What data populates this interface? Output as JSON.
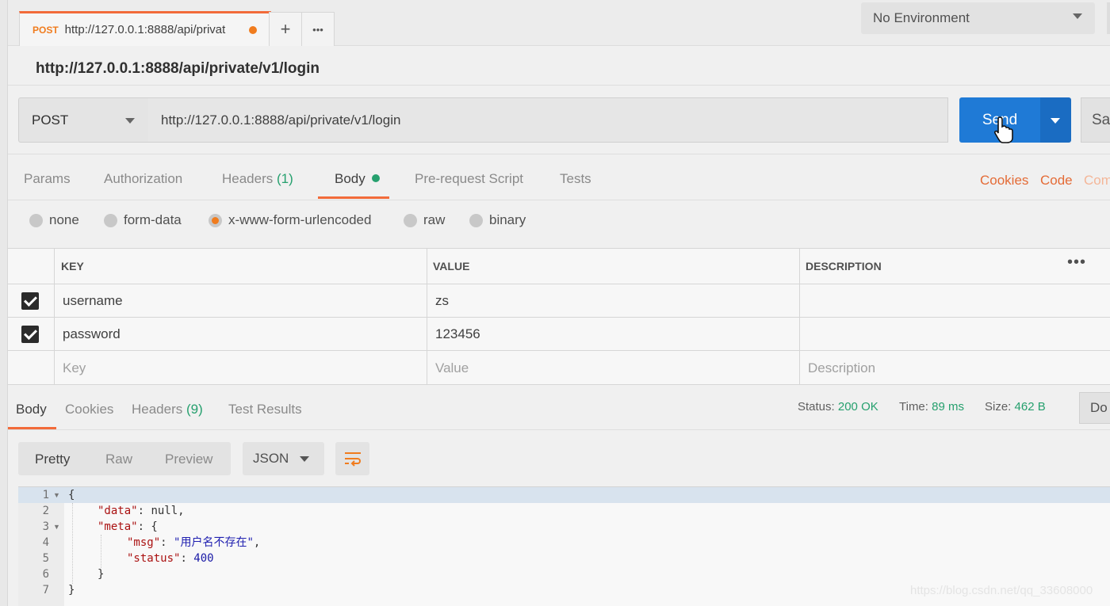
{
  "tabs": {
    "active": {
      "method": "POST",
      "url": "http://127.0.0.1:8888/api/privat"
    },
    "add_label": "+",
    "more_label": "•••"
  },
  "environment": {
    "selected": "No Environment"
  },
  "request": {
    "title": "http://127.0.0.1:8888/api/private/v1/login",
    "method": "POST",
    "url": "http://127.0.0.1:8888/api/private/v1/login",
    "send_label": "Send",
    "save_label": "Sa"
  },
  "request_tabs": {
    "params": "Params",
    "authorization": "Authorization",
    "headers": "Headers",
    "headers_count": "(1)",
    "body": "Body",
    "prerequest": "Pre-request Script",
    "tests": "Tests",
    "cookies": "Cookies",
    "code": "Code",
    "comments": "Com"
  },
  "body_types": {
    "none": "none",
    "form_data": "form-data",
    "urlencoded": "x-www-form-urlencoded",
    "raw": "raw",
    "binary": "binary",
    "selected": "x-www-form-urlencoded"
  },
  "params_table": {
    "headers": {
      "key": "KEY",
      "value": "VALUE",
      "description": "DESCRIPTION"
    },
    "more_label": "•••",
    "rows": [
      {
        "key": "username",
        "value": "zs",
        "description": "",
        "checked": true
      },
      {
        "key": "password",
        "value": "123456",
        "description": "",
        "checked": true
      }
    ],
    "placeholders": {
      "key": "Key",
      "value": "Value",
      "description": "Description"
    }
  },
  "response_tabs": {
    "body": "Body",
    "cookies": "Cookies",
    "headers": "Headers",
    "headers_count": "(9)",
    "test_results": "Test Results"
  },
  "response_meta": {
    "status_label": "Status:",
    "status_value": "200 OK",
    "time_label": "Time:",
    "time_value": "89 ms",
    "size_label": "Size:",
    "size_value": "462 B",
    "download_label": "Do"
  },
  "view": {
    "pretty": "Pretty",
    "raw": "Raw",
    "preview": "Preview",
    "format": "JSON"
  },
  "response_body": {
    "line_numbers": [
      "1",
      "2",
      "3",
      "4",
      "5",
      "6",
      "7"
    ],
    "open_brace": "{",
    "data_key": "\"data\"",
    "data_value": "null",
    "meta_key": "\"meta\"",
    "msg_key": "\"msg\"",
    "msg_value": "\"用户名不存在\"",
    "status_key": "\"status\"",
    "status_value": "400",
    "close_inner": "}",
    "close_outer": "}"
  },
  "watermark": "https://blog.csdn.net/qq_33608000",
  "colors": {
    "accent": "#f26b3a",
    "send_blue": "#1f7ad6",
    "status_green": "#26a06e"
  }
}
